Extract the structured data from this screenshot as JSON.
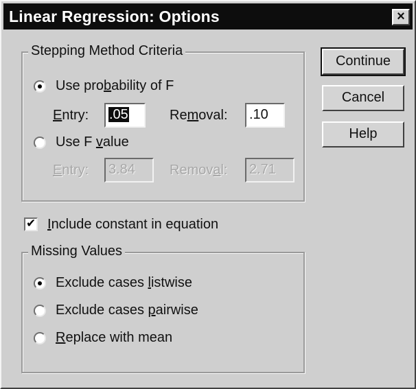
{
  "window": {
    "title": "Linear Regression: Options",
    "close_label": "×"
  },
  "stepping": {
    "legend": "Stepping Method Criteria",
    "use_probability": {
      "label_pre": "Use pro",
      "label_u": "b",
      "label_post": "ability of F",
      "selected": true
    },
    "prob_entry": {
      "label_u": "E",
      "label_post": "ntry:",
      "value": ".05"
    },
    "prob_removal": {
      "label_pre": "Re",
      "label_u": "m",
      "label_post": "oval:",
      "value": ".10"
    },
    "use_f": {
      "label_pre": "Use F ",
      "label_u": "v",
      "label_post": "alue",
      "selected": false
    },
    "f_entry": {
      "label_u": "E",
      "label_post": "ntry:",
      "value": "3.84"
    },
    "f_removal": {
      "label_pre": "Remov",
      "label_u": "a",
      "label_post": "l:",
      "value": "2.71"
    }
  },
  "include_constant": {
    "label_u": "I",
    "label_post": "nclude constant in equation",
    "checked": true,
    "check_glyph": "✔"
  },
  "missing": {
    "legend": "Missing Values",
    "listwise": {
      "label_pre": "Exclude cases ",
      "label_u": "l",
      "label_post": "istwise",
      "selected": true
    },
    "pairwise": {
      "label_pre": "Exclude cases ",
      "label_u": "p",
      "label_post": "airwise",
      "selected": false
    },
    "mean": {
      "label_u": "R",
      "label_post": "eplace with mean",
      "selected": false
    }
  },
  "buttons": {
    "continue": "Continue",
    "cancel": "Cancel",
    "help": "Help"
  }
}
